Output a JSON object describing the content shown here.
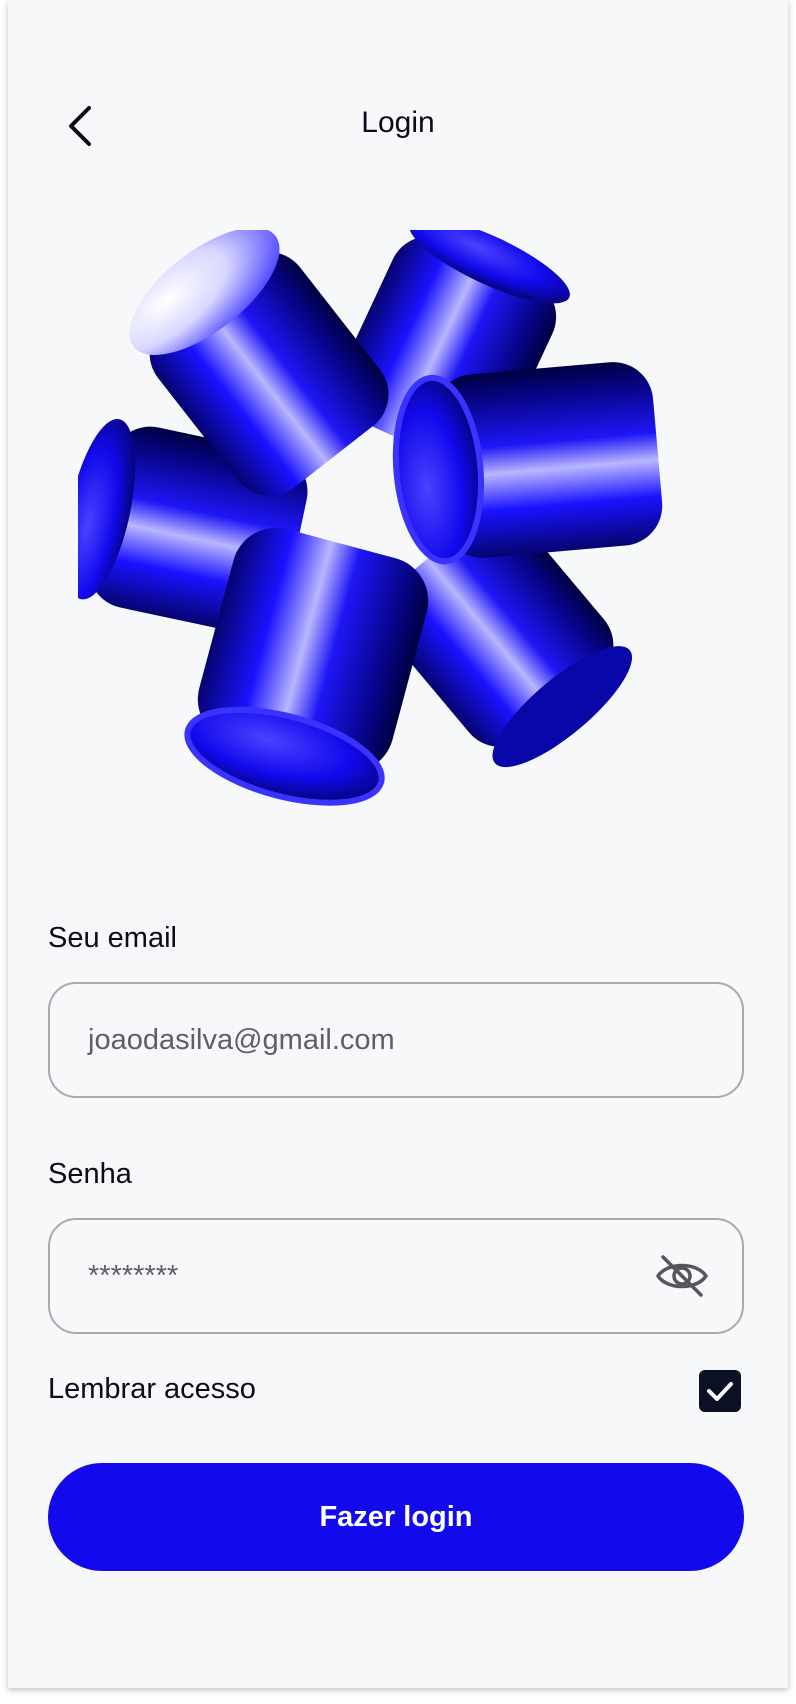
{
  "header": {
    "title": "Login",
    "back_icon": "chevron-left-icon"
  },
  "hero": {
    "image": "blue-3d-cylinders-illustration",
    "color": "#1209ec"
  },
  "form": {
    "email_label": "Seu email",
    "email_value": "joaodasilva@gmail.com",
    "password_label": "Senha",
    "password_value": "********",
    "password_toggle_icon": "eye-off-icon",
    "remember_label": "Lembrar acesso",
    "remember_checked": true
  },
  "actions": {
    "login_label": "Fazer login"
  },
  "colors": {
    "accent": "#1209ec",
    "background": "#f7f8fa",
    "checkbox": "#0c1024"
  }
}
